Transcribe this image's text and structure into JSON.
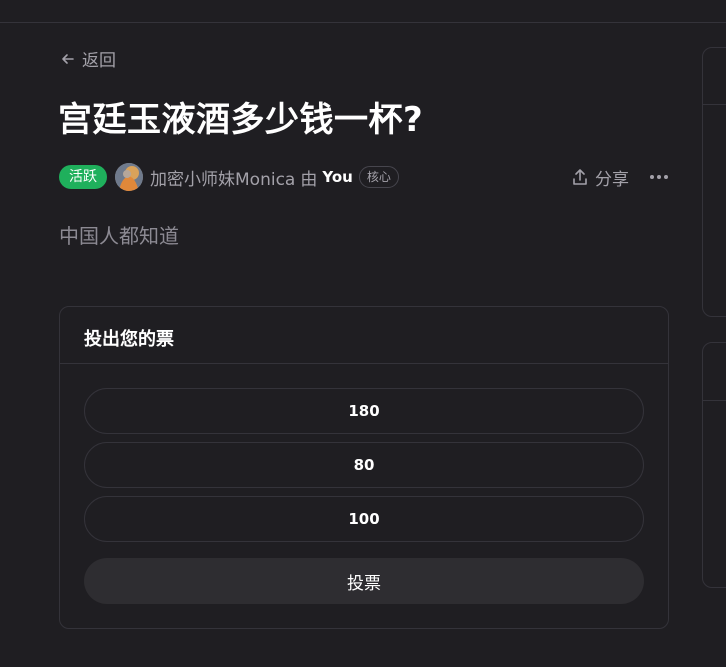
{
  "nav": {
    "back_label": "返回"
  },
  "post": {
    "title": "宫廷玉液酒多少钱一杯?",
    "status_badge": "活跃",
    "author": "加密小师妹Monica",
    "by_label": "由",
    "by_user": "You",
    "role_badge": "核心",
    "description": "中国人都知道"
  },
  "actions": {
    "share_label": "分享",
    "more_icon": "more-horizontal-icon"
  },
  "poll": {
    "title": "投出您的票",
    "options": [
      "180",
      "80",
      "100"
    ],
    "vote_label": "投票"
  },
  "colors": {
    "background": "#1f1e22",
    "active_badge": "#1fb05c",
    "muted_text": "#a3a1a9",
    "border": "#34333a",
    "vote_button": "#2e2d31"
  }
}
